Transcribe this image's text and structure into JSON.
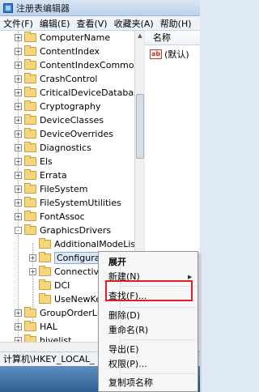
{
  "window": {
    "title": "注册表编辑器"
  },
  "menu": [
    "文件(F)",
    "编辑(E)",
    "查看(V)",
    "收藏夹(A)",
    "帮助(H)"
  ],
  "tree": {
    "nodes": [
      {
        "label": "ComputerName",
        "expander": "+"
      },
      {
        "label": "ContentIndex",
        "expander": "+"
      },
      {
        "label": "ContentIndexCommon",
        "expander": "+"
      },
      {
        "label": "CrashControl",
        "expander": "+"
      },
      {
        "label": "CriticalDeviceDatabase",
        "expander": "+"
      },
      {
        "label": "Cryptography",
        "expander": "+"
      },
      {
        "label": "DeviceClasses",
        "expander": "+"
      },
      {
        "label": "DeviceOverrides",
        "expander": "+"
      },
      {
        "label": "Diagnostics",
        "expander": "+"
      },
      {
        "label": "Els",
        "expander": "+"
      },
      {
        "label": "Errata",
        "expander": "+"
      },
      {
        "label": "FileSystem",
        "expander": "+"
      },
      {
        "label": "FileSystemUtilities",
        "expander": "+"
      },
      {
        "label": "FontAssoc",
        "expander": "+"
      },
      {
        "label": "GraphicsDrivers",
        "expander": "-"
      },
      {
        "label": "AdditionalModeLists",
        "expander": ""
      },
      {
        "label": "Configuration",
        "expander": "+"
      },
      {
        "label": "Connectivity",
        "expander": "+"
      },
      {
        "label": "DCI",
        "expander": ""
      },
      {
        "label": "UseNewKey",
        "expander": ""
      },
      {
        "label": "GroupOrderList",
        "expander": "+"
      },
      {
        "label": "HAL",
        "expander": "+"
      },
      {
        "label": "hivelist",
        "expander": "+"
      }
    ]
  },
  "list": {
    "column_name": "名称",
    "default_value": "(默认)",
    "value_type_icon": "ab"
  },
  "status": {
    "path": "计算机\\HKEY_LOCAL_"
  },
  "context_menu": {
    "items": [
      "展开",
      "新建(N)",
      "查找(F)...",
      "删除(D)",
      "重命名(R)",
      "导出(E)",
      "权限(P)...",
      "复制项名称"
    ],
    "bold_item": "展开",
    "highlighted_item": "查找(F)...",
    "highlight_color": "#e02020"
  }
}
